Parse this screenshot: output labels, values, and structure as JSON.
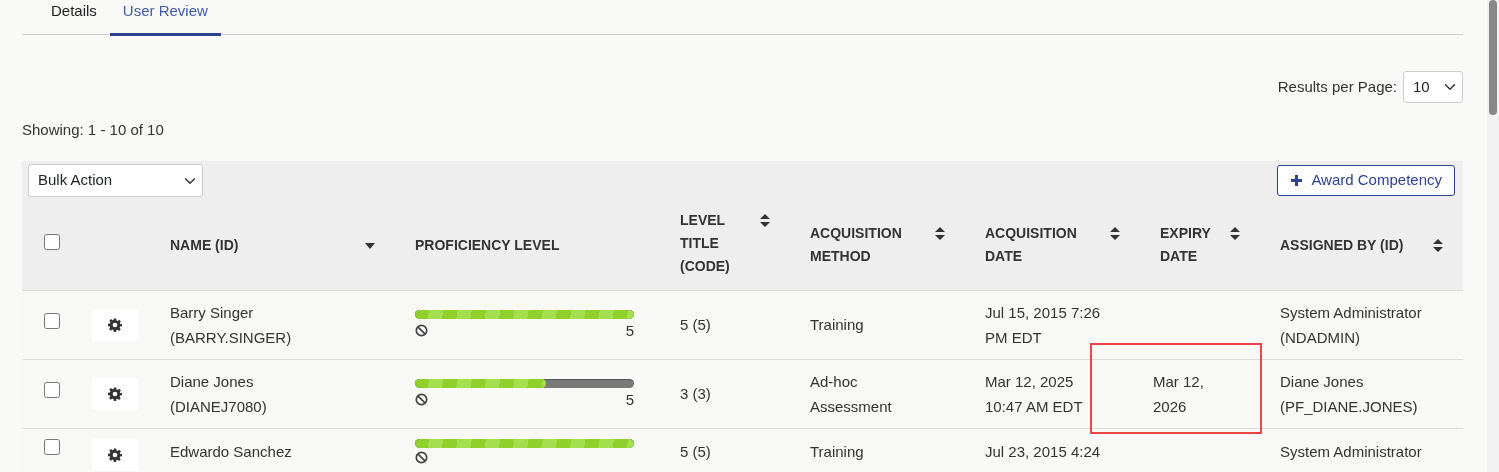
{
  "tabs": [
    {
      "label": "Details",
      "selected": false
    },
    {
      "label": "User Review",
      "selected": true
    }
  ],
  "results_per_page": {
    "label": "Results per Page:",
    "value": "10"
  },
  "showing": "Showing: 1 - 10 of 10",
  "bulk_action": {
    "value": "Bulk Action"
  },
  "award_button": {
    "label": "Award Competency"
  },
  "table": {
    "select_all_checked": false,
    "columns": [
      {
        "label": "NAME (ID)",
        "sortable": true,
        "sorted": true
      },
      {
        "label": "PROFICIENCY LEVEL",
        "sortable": false
      },
      {
        "label": "LEVEL TITLE (CODE)",
        "sortable": true,
        "sorted": false
      },
      {
        "label": "ACQUISITION METHOD",
        "sortable": true,
        "sorted": false
      },
      {
        "label": "ACQUISITION DATE",
        "sortable": true,
        "sorted": false
      },
      {
        "label": "EXPIRY DATE",
        "sortable": true,
        "sorted": false
      },
      {
        "label": "ASSIGNED BY (ID)",
        "sortable": true,
        "sorted": false
      }
    ],
    "rows": [
      {
        "checked": false,
        "name": "Barry Singer (BARRY.SINGER)",
        "level": 1,
        "max": "5",
        "level_title": "5 (5)",
        "method": "Training",
        "acq_date": "Jul 15, 2015 7:26 PM EDT",
        "assigned_by": "System Administrator (NDADMIN)"
      },
      {
        "checked": false,
        "name": "Diane Jones (DIANEJ7080)",
        "level": 0.6,
        "max": "5",
        "level_title": "3 (3)",
        "method": "Ad-hoc Assessment",
        "acq_date": "Mar 12, 2025 10:47 AM EDT",
        "expiry": "Mar 12, 2026",
        "expiry_highlighted": true,
        "assigned_by": "Diane Jones (PF_DIANE.JONES)"
      },
      {
        "checked": false,
        "name": "Edwardo Sanchez",
        "level": 1,
        "level_title": "5 (5)",
        "method": "Training",
        "acq_date": "Jul 23, 2015 4:24",
        "assigned_by": "System Administrator"
      }
    ]
  }
}
